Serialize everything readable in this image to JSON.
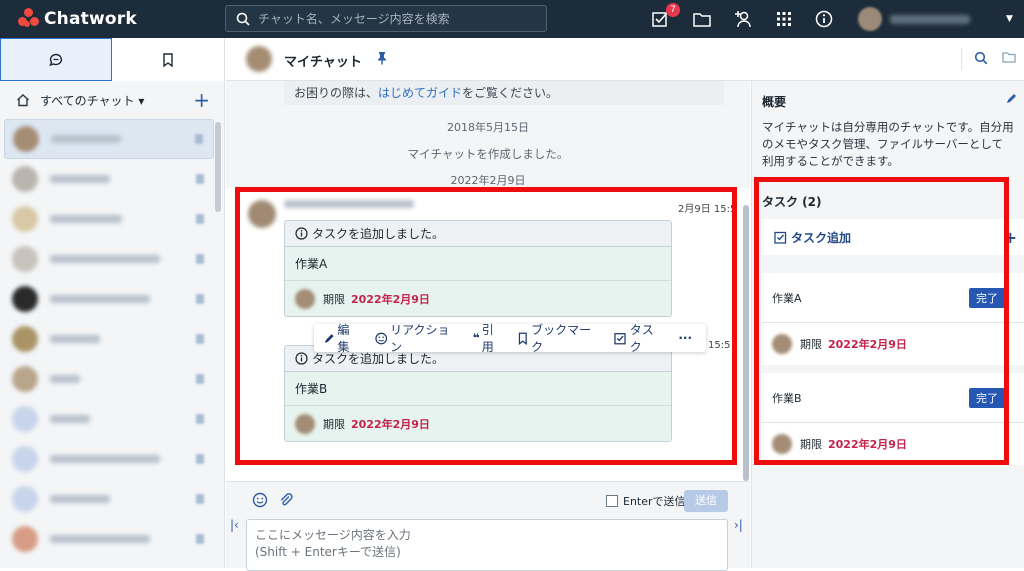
{
  "app": {
    "name": "Chatwork"
  },
  "header": {
    "search_placeholder": "チャット名、メッセージ内容を検索",
    "task_badge": "7"
  },
  "sidebar": {
    "all_chats_label": "すべてのチャット ▾",
    "room_count": 11
  },
  "room": {
    "title": "マイチャット"
  },
  "timeline": {
    "guide_prefix": "お困りの際は、",
    "guide_link": "はじめてガイド",
    "guide_suffix": "をご覧ください。",
    "date1": "2018年5月15日",
    "created": "マイチャットを作成しました。",
    "date2": "2022年2月9日",
    "message_time": "2月9日 15:5",
    "message2_time": "15:5",
    "messages": [
      {
        "header": "タスクを追加しました。",
        "task": "作業A",
        "due_label": "期限",
        "due_date": "2022年2月9日"
      },
      {
        "header": "タスクを追加しました。",
        "task": "作業B",
        "due_label": "期限",
        "due_date": "2022年2月9日"
      }
    ],
    "actions": {
      "edit": "編集",
      "reaction": "リアクション",
      "quote": "引用",
      "bookmark": "ブックマーク",
      "task": "タスク",
      "more": "···"
    }
  },
  "composer": {
    "enter_send": "Enterで送信",
    "send": "送信",
    "placeholder": "ここにメッセージ内容を入力\n(Shift + Enterキーで送信)"
  },
  "right_panel": {
    "overview_title": "概要",
    "description": "マイチャットは自分専用のチャットです。自分用のメモやタスク管理、ファイルサーバーとして利用することができます。",
    "tasks_title": "タスク (2)",
    "task_add": "タスク追加",
    "tasks": [
      {
        "name": "作業A",
        "done_label": "完了",
        "due_label": "期限",
        "due_date": "2022年2月9日"
      },
      {
        "name": "作業B",
        "done_label": "完了",
        "due_label": "期限",
        "due_date": "2022年2月9日"
      }
    ]
  },
  "colors": {
    "topbar": "#1d2c3a",
    "accent": "#2658b3",
    "due_red": "#c4234d",
    "highlight_red": "#ee0c0c"
  }
}
